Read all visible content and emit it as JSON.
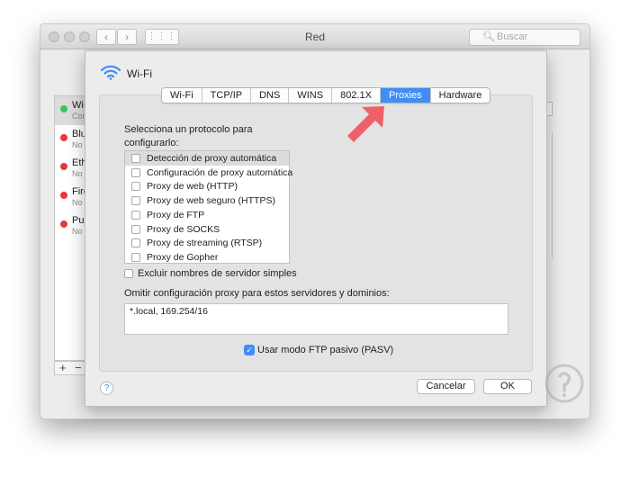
{
  "window": {
    "title": "Red",
    "search_placeholder": "Buscar"
  },
  "networks": [
    {
      "name": "Wi-Fi",
      "status": "Conectado",
      "color": "#34c759"
    },
    {
      "name": "Bluetooth PAN",
      "status": "No conectado",
      "color": "#e5383b"
    },
    {
      "name": "Ethernet",
      "status": "No conectado",
      "color": "#e5383b"
    },
    {
      "name": "FireWire",
      "status": "No conectado",
      "color": "#e5383b"
    },
    {
      "name": "Puente Thunderbolt",
      "status": "No conectado",
      "color": "#e5383b"
    }
  ],
  "list_controls": {
    "add": "+",
    "remove": "−"
  },
  "sheet": {
    "title": "Wi-Fi",
    "tabs": [
      {
        "label": "Wi-Fi",
        "active": false
      },
      {
        "label": "TCP/IP",
        "active": false
      },
      {
        "label": "DNS",
        "active": false
      },
      {
        "label": "WINS",
        "active": false
      },
      {
        "label": "802.1X",
        "active": false
      },
      {
        "label": "Proxies",
        "active": true
      },
      {
        "label": "Hardware",
        "active": false
      }
    ],
    "protocol_label": "Selecciona un protocolo para configurarlo:",
    "protocols": [
      {
        "label": "Detección de proxy automática",
        "checked": false,
        "selected": true
      },
      {
        "label": "Configuración de proxy automática",
        "checked": false,
        "selected": false
      },
      {
        "label": "Proxy de web (HTTP)",
        "checked": false,
        "selected": false
      },
      {
        "label": "Proxy de web seguro (HTTPS)",
        "checked": false,
        "selected": false
      },
      {
        "label": "Proxy de FTP",
        "checked": false,
        "selected": false
      },
      {
        "label": "Proxy de SOCKS",
        "checked": false,
        "selected": false
      },
      {
        "label": "Proxy de streaming (RTSP)",
        "checked": false,
        "selected": false
      },
      {
        "label": "Proxy de Gopher",
        "checked": false,
        "selected": false
      }
    ],
    "exclude_simple": {
      "label": "Excluir nombres de servidor simples",
      "checked": false
    },
    "bypass_label": "Omitir configuración proxy para estos servidores y dominios:",
    "bypass_value": "*.local, 169.254/16",
    "passive_ftp": {
      "label": "Usar modo FTP pasivo (PASV)",
      "checked": true
    },
    "help": "?",
    "cancel_label": "Cancelar",
    "ok_label": "OK"
  },
  "colors": {
    "accent": "#3f8ef5",
    "arrow": "#f0606a",
    "connected": "#34c759",
    "disconnected": "#e5383b"
  }
}
